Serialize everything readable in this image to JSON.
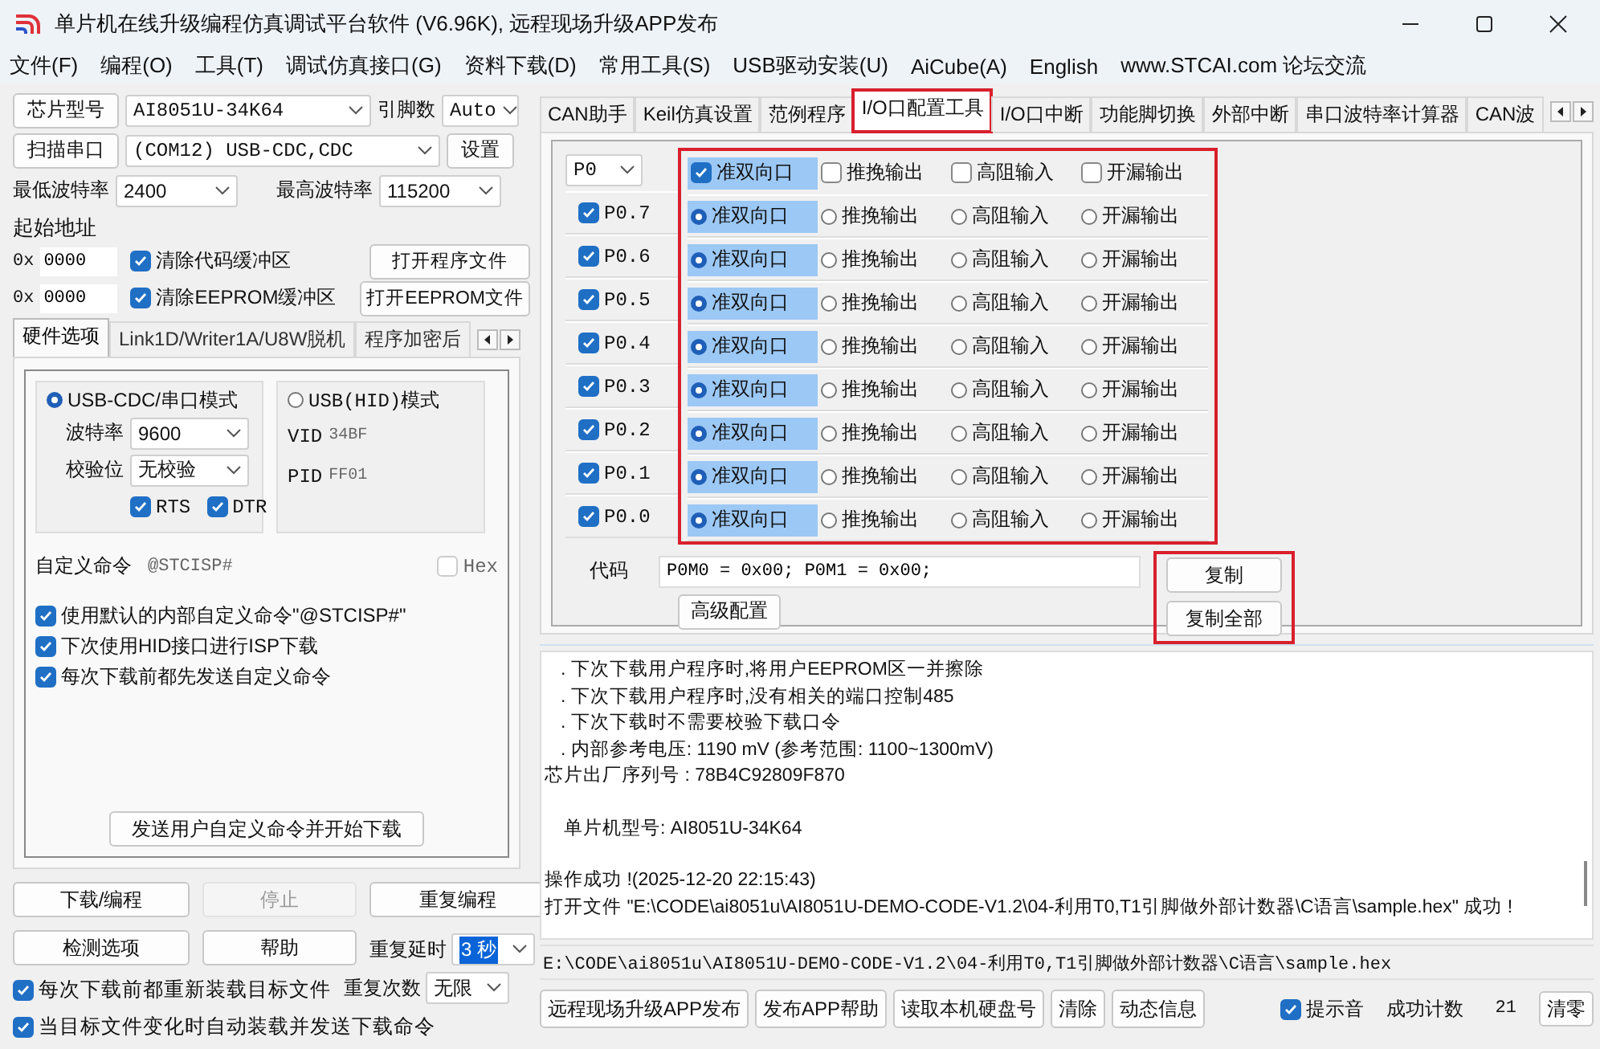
{
  "window": {
    "title": "单片机在线升级编程仿真调试平台软件 (V6.96K), 远程现场升级APP发布"
  },
  "menu": [
    "文件(F)",
    "编程(O)",
    "工具(T)",
    "调试仿真接口(G)",
    "资料下载(D)",
    "常用工具(S)",
    "USB驱动安装(U)",
    "AiCube(A)",
    "English",
    "www.STCAI.com 论坛交流"
  ],
  "left": {
    "chip": {
      "button": "芯片型号",
      "value": "AI8051U-34K64",
      "pins_label": "引脚数",
      "pins_value": "Auto"
    },
    "port": {
      "button": "扫描串口",
      "value": "(COM12) USB-CDC,CDC",
      "settings": "设置"
    },
    "baud": {
      "min_label": "最低波特率",
      "min_value": "2400",
      "max_label": "最高波特率",
      "max_value": "115200"
    },
    "start_address": {
      "label": "起始地址",
      "rows": [
        {
          "prefix": "0x",
          "value": "0000",
          "checkbox": "清除代码缓冲区",
          "checked": true,
          "button": "打开程序文件"
        },
        {
          "prefix": "0x",
          "value": "0000",
          "checkbox": "清除EEPROM缓冲区",
          "checked": true,
          "button": "打开EEPROM文件"
        }
      ]
    },
    "tabs": [
      {
        "label": "硬件选项",
        "selected": true
      },
      {
        "label": "Link1D/Writer1A/U8W脱机",
        "selected": false
      },
      {
        "label": "程序加密后",
        "selected": false
      }
    ],
    "hardware": {
      "serial_mode": {
        "label": "USB-CDC/串口模式",
        "selected": true,
        "baud_label": "波特率",
        "baud_value": "9600",
        "parity_label": "校验位",
        "parity_value": "无校验",
        "flags": [
          {
            "label": "RTS",
            "checked": true
          },
          {
            "label": "DTR",
            "checked": true
          }
        ]
      },
      "hid_mode": {
        "label": "USB(HID)模式",
        "selected": false,
        "vid_label": "VID",
        "vid_value": "34BF",
        "pid_label": "PID",
        "pid_value": "FF01"
      },
      "custom_command": {
        "label": "自定义命令",
        "value": "@STCISP#",
        "hex_label": "Hex",
        "hex_checked": false
      },
      "options": [
        {
          "label": "使用默认的内部自定义命令\"@STCISP#\"",
          "checked": true
        },
        {
          "label": "下次使用HID接口进行ISP下载",
          "checked": true
        },
        {
          "label": "每次下载前都先发送自定义命令",
          "checked": true
        }
      ],
      "send_button": "发送用户自定义命令并开始下载"
    },
    "buttons": [
      {
        "label": "下载/编程",
        "disabled": false
      },
      {
        "label": "停止",
        "disabled": true
      },
      {
        "label": "重复编程",
        "disabled": false
      },
      {
        "label": "检测选项",
        "disabled": false
      },
      {
        "label": "帮助",
        "disabled": false
      }
    ],
    "repeat_delay": {
      "label": "重复延时",
      "value": "3 秒"
    },
    "repeat_count": {
      "label": "重复次数",
      "value": "无限"
    },
    "auto_options": [
      {
        "label": "每次下载前都重新装载目标文件",
        "checked": true
      },
      {
        "label": "当目标文件变化时自动装载并发送下载命令",
        "checked": true
      }
    ]
  },
  "right": {
    "tabs": [
      {
        "label": "CAN助手",
        "selected": false,
        "highlighted": false
      },
      {
        "label": "Keil仿真设置",
        "selected": false,
        "highlighted": false
      },
      {
        "label": "范例程序",
        "selected": false,
        "highlighted": false
      },
      {
        "label": "I/O口配置工具",
        "selected": true,
        "highlighted": true
      },
      {
        "label": "I/O口中断",
        "selected": false,
        "highlighted": false
      },
      {
        "label": "功能脚切换",
        "selected": false,
        "highlighted": false
      },
      {
        "label": "外部中断",
        "selected": false,
        "highlighted": false
      },
      {
        "label": "串口波特率计算器",
        "selected": false,
        "highlighted": false
      },
      {
        "label": "CAN波",
        "selected": false,
        "highlighted": false
      }
    ],
    "io_tool": {
      "port_value": "P0",
      "highlighted": true,
      "header": [
        {
          "label": "准双向口",
          "checked": true
        },
        {
          "label": "推挽输出",
          "checked": false
        },
        {
          "label": "高阻输入",
          "checked": false
        },
        {
          "label": "开漏输出",
          "checked": false
        }
      ],
      "pins": [
        {
          "name": "P0.7",
          "checked": true,
          "modes": [
            {
              "label": "准双向口",
              "selected": true
            },
            {
              "label": "推挽输出",
              "selected": false
            },
            {
              "label": "高阻输入",
              "selected": false
            },
            {
              "label": "开漏输出",
              "selected": false
            }
          ]
        },
        {
          "name": "P0.6",
          "checked": true,
          "modes": [
            {
              "label": "准双向口",
              "selected": true
            },
            {
              "label": "推挽输出",
              "selected": false
            },
            {
              "label": "高阻输入",
              "selected": false
            },
            {
              "label": "开漏输出",
              "selected": false
            }
          ]
        },
        {
          "name": "P0.5",
          "checked": true,
          "modes": [
            {
              "label": "准双向口",
              "selected": true
            },
            {
              "label": "推挽输出",
              "selected": false
            },
            {
              "label": "高阻输入",
              "selected": false
            },
            {
              "label": "开漏输出",
              "selected": false
            }
          ]
        },
        {
          "name": "P0.4",
          "checked": true,
          "modes": [
            {
              "label": "准双向口",
              "selected": true
            },
            {
              "label": "推挽输出",
              "selected": false
            },
            {
              "label": "高阻输入",
              "selected": false
            },
            {
              "label": "开漏输出",
              "selected": false
            }
          ]
        },
        {
          "name": "P0.3",
          "checked": true,
          "modes": [
            {
              "label": "准双向口",
              "selected": true
            },
            {
              "label": "推挽输出",
              "selected": false
            },
            {
              "label": "高阻输入",
              "selected": false
            },
            {
              "label": "开漏输出",
              "selected": false
            }
          ]
        },
        {
          "name": "P0.2",
          "checked": true,
          "modes": [
            {
              "label": "准双向口",
              "selected": true
            },
            {
              "label": "推挽输出",
              "selected": false
            },
            {
              "label": "高阻输入",
              "selected": false
            },
            {
              "label": "开漏输出",
              "selected": false
            }
          ]
        },
        {
          "name": "P0.1",
          "checked": true,
          "modes": [
            {
              "label": "准双向口",
              "selected": true
            },
            {
              "label": "推挽输出",
              "selected": false
            },
            {
              "label": "高阻输入",
              "selected": false
            },
            {
              "label": "开漏输出",
              "selected": false
            }
          ]
        },
        {
          "name": "P0.0",
          "checked": true,
          "modes": [
            {
              "label": "准双向口",
              "selected": true
            },
            {
              "label": "推挽输出",
              "selected": false
            },
            {
              "label": "高阻输入",
              "selected": false
            },
            {
              "label": "开漏输出",
              "selected": false
            }
          ]
        }
      ],
      "code_label": "代码",
      "code_value": "P0M0 = 0x00; P0M1 = 0x00;",
      "advanced": "高级配置",
      "copy": "复制",
      "copy_all": "复制全部",
      "copy_highlighted": true
    },
    "log": [
      {
        "kind": "item",
        "text": ". 下次下载用户程序时,将用户EEPROM区一并擦除",
        "gap_before": false
      },
      {
        "kind": "item",
        "text": ". 下次下载用户程序时,没有相关的端口控制485",
        "gap_before": false
      },
      {
        "kind": "item",
        "text": ". 下次下载时不需要校验下载口令",
        "gap_before": false
      },
      {
        "kind": "item",
        "text": ". 内部参考电压: 1190 mV (参考范围: 1100~1300mV)",
        "gap_before": false
      },
      {
        "kind": "line",
        "text": "芯片出厂序列号 : 78B4C92809F870",
        "gap_before": false
      },
      {
        "kind": "indented",
        "text": "单片机型号: AI8051U-34K64",
        "gap_before": true
      },
      {
        "kind": "line",
        "text": "操作成功 !(2025-12-20 22:15:43)",
        "gap_before": true
      },
      {
        "kind": "line",
        "text": "打开文件 \"E:\\CODE\\ai8051u\\AI8051U-DEMO-CODE-V1.2\\04-利用T0,T1引脚做外部计数器\\C语言\\sample.hex\" 成功 !",
        "gap_before": false
      }
    ],
    "path": "E:\\CODE\\ai8051u\\AI8051U-DEMO-CODE-V1.2\\04-利用T0,T1引脚做外部计数器\\C语言\\sample.hex",
    "footer": {
      "buttons": [
        "远程现场升级APP发布",
        "发布APP帮助",
        "读取本机硬盘号",
        "清除",
        "动态信息"
      ],
      "sound": {
        "label": "提示音",
        "checked": true
      },
      "count_label": "成功计数",
      "count_value": "21",
      "reset": "清零"
    }
  }
}
